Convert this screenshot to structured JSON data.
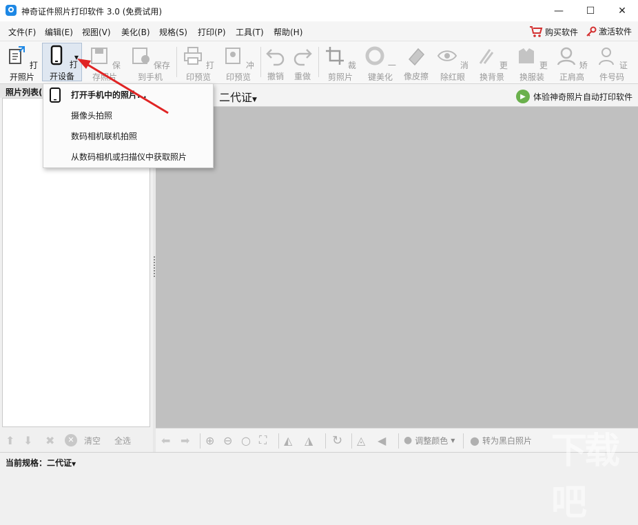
{
  "window": {
    "title": "神奇证件照片打印软件 3.0 (免费试用)",
    "controls": {
      "minimize": "—",
      "maximize": "☐",
      "close": "✕"
    }
  },
  "menu": {
    "items": [
      "文件(F)",
      "编辑(E)",
      "视图(V)",
      "美化(B)",
      "规格(S)",
      "打印(P)",
      "工具(T)",
      "帮助(H)"
    ],
    "buy": "购买软件",
    "activate": "激活软件"
  },
  "toolbar": {
    "items": [
      {
        "label": "打开照片",
        "icon": "open-photo-icon",
        "enabled": true
      },
      {
        "label": "打开设备",
        "icon": "phone-icon",
        "enabled": true
      },
      {
        "label": "保存照片",
        "icon": "save-icon",
        "enabled": false
      },
      {
        "label": "保存到手机",
        "icon": "save-to-phone-icon",
        "enabled": false
      },
      {
        "label": "打印预览",
        "icon": "print-preview-icon",
        "enabled": false
      },
      {
        "label": "冲印预览",
        "icon": "photo-print-preview-icon",
        "enabled": false
      },
      {
        "label": "撤销",
        "icon": "undo-icon",
        "enabled": false
      },
      {
        "label": "重做",
        "icon": "redo-icon",
        "enabled": false
      },
      {
        "label": "裁剪照片",
        "icon": "crop-icon",
        "enabled": false
      },
      {
        "label": "一键美化",
        "icon": "beautify-icon",
        "enabled": false
      },
      {
        "label": "像皮擦",
        "icon": "eraser-icon",
        "enabled": false
      },
      {
        "label": "消除红眼",
        "icon": "red-eye-icon",
        "enabled": false
      },
      {
        "label": "更换背景",
        "icon": "background-icon",
        "enabled": false
      },
      {
        "label": "更换服装",
        "icon": "clothes-icon",
        "enabled": false
      },
      {
        "label": "矫正肩高",
        "icon": "shoulder-icon",
        "enabled": false
      },
      {
        "label": "证件号码",
        "icon": "id-number-icon",
        "enabled": false
      }
    ]
  },
  "left_panel": {
    "title": "照片列表(",
    "clear": "清空",
    "select_all": "全选"
  },
  "main": {
    "spec_label": "二代证",
    "auto_print": "体验神奇照片自动打印软件",
    "adjust_color": "调整颜色",
    "to_bw": "转为黑白照片"
  },
  "status": {
    "label": "当前规格：",
    "value": "二代证"
  },
  "dropdown": {
    "items": [
      "打开手机中的照片...",
      "摄像头拍照",
      "数码相机联机拍照",
      "从数码相机或扫描仪中获取照片"
    ]
  },
  "watermark": "下载吧",
  "colors": {
    "canvas": "#c0c0c0",
    "accent": "#1e88e5",
    "arrow": "#e02424",
    "buy": "#d32f2f"
  }
}
